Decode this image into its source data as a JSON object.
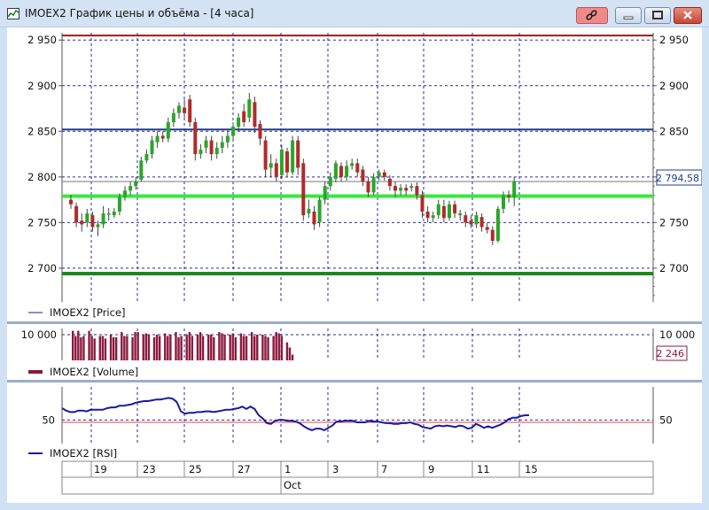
{
  "window": {
    "title": "IMOEX2 График цены и объёма - [4 часа]"
  },
  "colors": {
    "price_bull": "#2aa62a",
    "price_bear": "#b02b2b",
    "volume": "#8b1a3c",
    "rsi": "#1a1aa0",
    "grid": "#2a2aa0",
    "line_blue": "#1f3f8a",
    "line_bright_green": "#37e83d",
    "line_dark_green": "#1a8a1a",
    "line_top_red": "#9b1b1b",
    "rsi_ref_red": "#e04a4a"
  },
  "chart_data": [
    {
      "type": "candlestick",
      "series_name": "IMOEX2 [Price]",
      "y_ticks": [
        "2 700",
        "2 750",
        "2 800",
        "2 850",
        "2 900",
        "2 950"
      ],
      "ylim": [
        2663,
        2958
      ],
      "last_value": "2 794,58",
      "horizontal_lines": [
        {
          "y": 2955,
          "color": "dark red"
        },
        {
          "y": 2852,
          "color": "blue"
        },
        {
          "y": 2779,
          "color": "bright green"
        },
        {
          "y": 2694,
          "color": "dark green"
        },
        {
          "y": 2795,
          "color": "grey"
        }
      ],
      "candles": [
        [
          2775,
          2770,
          2780,
          2765
        ],
        [
          2768,
          2750,
          2772,
          2745
        ],
        [
          2752,
          2748,
          2760,
          2740
        ],
        [
          2750,
          2760,
          2765,
          2745
        ],
        [
          2758,
          2745,
          2762,
          2740
        ],
        [
          2745,
          2748,
          2752,
          2735
        ],
        [
          2748,
          2760,
          2768,
          2744
        ],
        [
          2760,
          2760,
          2766,
          2752
        ],
        [
          2758,
          2762,
          2766,
          2755
        ],
        [
          2762,
          2778,
          2782,
          2758
        ],
        [
          2778,
          2785,
          2790,
          2774
        ],
        [
          2785,
          2790,
          2795,
          2780
        ],
        [
          2790,
          2795,
          2800,
          2786
        ],
        [
          2797,
          2818,
          2822,
          2795
        ],
        [
          2818,
          2825,
          2830,
          2815
        ],
        [
          2825,
          2840,
          2845,
          2820
        ],
        [
          2838,
          2845,
          2850,
          2832
        ],
        [
          2845,
          2842,
          2850,
          2838
        ],
        [
          2842,
          2860,
          2865,
          2838
        ],
        [
          2860,
          2870,
          2875,
          2855
        ],
        [
          2870,
          2878,
          2882,
          2864
        ],
        [
          2876,
          2870,
          2885,
          2862
        ],
        [
          2885,
          2860,
          2890,
          2855
        ],
        [
          2860,
          2825,
          2865,
          2818
        ],
        [
          2825,
          2830,
          2836,
          2820
        ],
        [
          2832,
          2840,
          2845,
          2826
        ],
        [
          2840,
          2825,
          2845,
          2818
        ],
        [
          2825,
          2832,
          2838,
          2820
        ],
        [
          2832,
          2838,
          2845,
          2826
        ],
        [
          2838,
          2845,
          2850,
          2832
        ],
        [
          2845,
          2855,
          2860,
          2840
        ],
        [
          2855,
          2865,
          2870,
          2850
        ],
        [
          2872,
          2860,
          2880,
          2855
        ],
        [
          2865,
          2885,
          2892,
          2860
        ],
        [
          2882,
          2855,
          2888,
          2848
        ],
        [
          2858,
          2842,
          2862,
          2835
        ],
        [
          2840,
          2808,
          2845,
          2800
        ],
        [
          2810,
          2815,
          2825,
          2800
        ],
        [
          2815,
          2800,
          2820,
          2795
        ],
        [
          2802,
          2830,
          2835,
          2798
        ],
        [
          2828,
          2805,
          2832,
          2800
        ],
        [
          2805,
          2840,
          2845,
          2802
        ],
        [
          2840,
          2810,
          2845,
          2802
        ],
        [
          2815,
          2758,
          2820,
          2752
        ],
        [
          2760,
          2765,
          2775,
          2755
        ],
        [
          2762,
          2748,
          2768,
          2742
        ],
        [
          2750,
          2775,
          2778,
          2745
        ],
        [
          2775,
          2790,
          2795,
          2770
        ],
        [
          2790,
          2800,
          2805,
          2785
        ],
        [
          2798,
          2815,
          2818,
          2794
        ],
        [
          2812,
          2800,
          2816,
          2795
        ],
        [
          2800,
          2812,
          2818,
          2796
        ],
        [
          2812,
          2815,
          2820,
          2808
        ],
        [
          2815,
          2805,
          2820,
          2800
        ],
        [
          2808,
          2795,
          2812,
          2790
        ],
        [
          2795,
          2783,
          2800,
          2778
        ],
        [
          2783,
          2800,
          2804,
          2780
        ],
        [
          2800,
          2805,
          2808,
          2796
        ],
        [
          2805,
          2800,
          2808,
          2796
        ],
        [
          2798,
          2790,
          2802,
          2785
        ],
        [
          2790,
          2785,
          2795,
          2778
        ],
        [
          2785,
          2788,
          2792,
          2780
        ],
        [
          2788,
          2785,
          2792,
          2780
        ],
        [
          2788,
          2790,
          2793,
          2784
        ],
        [
          2790,
          2780,
          2794,
          2775
        ],
        [
          2780,
          2762,
          2785,
          2755
        ],
        [
          2762,
          2755,
          2768,
          2750
        ],
        [
          2755,
          2758,
          2762,
          2750
        ],
        [
          2758,
          2770,
          2775,
          2754
        ],
        [
          2768,
          2755,
          2775,
          2750
        ],
        [
          2755,
          2770,
          2774,
          2752
        ],
        [
          2770,
          2760,
          2774,
          2755
        ],
        [
          2758,
          2760,
          2764,
          2752
        ],
        [
          2758,
          2750,
          2762,
          2745
        ],
        [
          2752,
          2748,
          2758,
          2744
        ],
        [
          2748,
          2758,
          2762,
          2744
        ],
        [
          2756,
          2745,
          2760,
          2740
        ],
        [
          2745,
          2742,
          2750,
          2738
        ],
        [
          2742,
          2730,
          2746,
          2725
        ],
        [
          2730,
          2765,
          2768,
          2728
        ],
        [
          2765,
          2780,
          2784,
          2760
        ],
        [
          2780,
          2778,
          2785,
          2772
        ],
        [
          2778,
          2795,
          2800,
          2768
        ]
      ]
    },
    {
      "type": "bar",
      "series_name": "IMOEX2 [Volume]",
      "y_ticks": [
        "10 000"
      ],
      "ylim": [
        0,
        12400
      ],
      "last_value": "2 246",
      "values": [
        11500,
        9500,
        11500,
        9000,
        9500,
        0,
        11500,
        9500,
        8500,
        0,
        9500,
        9500,
        8500,
        0,
        10000,
        9000,
        9000,
        0,
        11000,
        9500,
        9500,
        0,
        9000,
        11000,
        11000,
        0,
        10000,
        10500,
        10000,
        0,
        9000,
        10000,
        9500,
        0,
        10500,
        9500,
        10000,
        0,
        11000,
        9000,
        9500,
        0,
        10000,
        11000,
        9500,
        0,
        10000,
        11000,
        9500,
        0,
        10000,
        10000,
        9000,
        0,
        11000,
        10500,
        10000,
        0,
        10000,
        10500,
        9000,
        0,
        10500,
        9500,
        9500,
        0,
        11000,
        9500,
        10000,
        0,
        10000,
        9500,
        9000,
        0,
        9500,
        11000,
        10500,
        9500,
        0,
        7000,
        5000,
        2246
      ]
    },
    {
      "type": "line",
      "series_name": "IMOEX2 [RSI]",
      "y_ticks": [
        "50"
      ],
      "ylim": [
        20,
        92
      ],
      "reference_line": 47,
      "values": [
        65,
        62,
        60,
        60,
        62,
        62,
        61,
        63,
        63,
        63,
        63,
        65,
        66,
        66,
        68,
        68,
        69,
        70,
        72,
        73,
        74,
        74,
        75,
        76,
        76,
        77,
        78,
        77,
        73,
        61,
        58,
        59,
        59,
        60,
        60,
        61,
        61,
        60,
        61,
        62,
        63,
        63,
        64,
        65,
        67,
        64,
        67,
        64,
        56,
        52,
        46,
        45,
        49,
        50,
        50,
        49,
        49,
        48,
        46,
        42,
        39,
        37,
        39,
        39,
        37,
        40,
        43,
        48,
        48,
        49,
        49,
        49,
        47,
        47,
        47,
        49,
        48,
        48,
        47,
        46,
        46,
        45,
        45,
        46,
        46,
        47,
        45,
        44,
        41,
        40,
        39,
        42,
        43,
        42,
        43,
        42,
        41,
        43,
        42,
        39,
        40,
        45,
        43,
        40,
        42,
        40,
        42,
        44,
        47,
        51,
        53,
        53,
        55,
        56,
        56
      ]
    }
  ],
  "legends": {
    "price": "IMOEX2 [Price]",
    "volume": "IMOEX2 [Volume]",
    "rsi": "IMOEX2 [RSI]"
  },
  "x_axis": {
    "day_labels": [
      "19",
      "23",
      "25",
      "27",
      "1",
      "3",
      "7",
      "9",
      "11",
      "15"
    ],
    "month_label": "Oct"
  }
}
